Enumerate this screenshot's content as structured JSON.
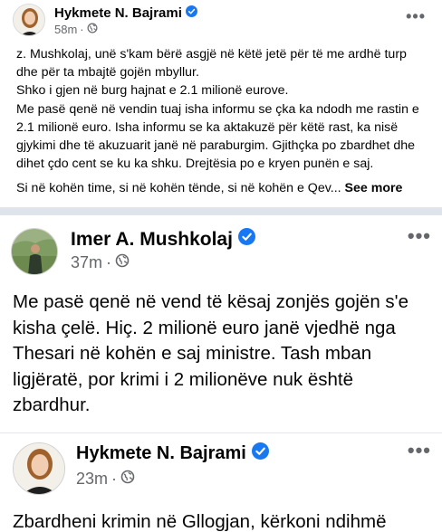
{
  "post1": {
    "author": "Hykmete N. Bajrami",
    "time": "58m",
    "dot": "·",
    "more": "•••",
    "lines": [
      "z. Mushkolaj, unë s'kam bërë asgjë në këtë jetë për të me ardhë turp",
      "dhe për ta mbajtë gojën mbyllur.",
      "Shko i gjen në burg hajnat e 2.1 milionë eurove.",
      "Me pasë qenë në vendin tuaj isha informu se çka ka ndodh me rastin e",
      "2.1 milionë euro. Isha informu se ka aktakuzë për këtë rast, ka nisë",
      "gjykimi dhe të akuzuarit janë në paraburgim. Gjithçka po zbardhet dhe",
      "dihet çdo cent se ku ka shku. Drejtësia po e kryen punën e saj."
    ],
    "last_line": "Si në kohën time, si në kohën tënde, si në kohën e Qev...",
    "see_more": "See more"
  },
  "post2": {
    "author": "Imer A. Mushkolaj",
    "time": "37m",
    "dot": "·",
    "more": "•••",
    "lines": [
      "Me pasë qenë në vend të kësaj zonjës gojën s'e",
      "kisha çelë. Hiç. 2 milionë euro janë vjedhë nga",
      "Thesari në kohën e saj ministre. Tash mban",
      "ligjëratë, por krimi i 2 milionëve nuk është",
      "zbardhur."
    ]
  },
  "post3": {
    "author": "Hykmete N. Bajrami",
    "time": "23m",
    "dot": "·",
    "more": "•••",
    "line": "Zbardheni krimin në Gllogjan, kërkoni ndihmë"
  },
  "colors": {
    "verified": "#1877f2",
    "meta": "#65676b",
    "separator": "#dfe3ea"
  },
  "icons": [
    "verified-badge-icon",
    "globe-icon",
    "more-options-icon"
  ]
}
